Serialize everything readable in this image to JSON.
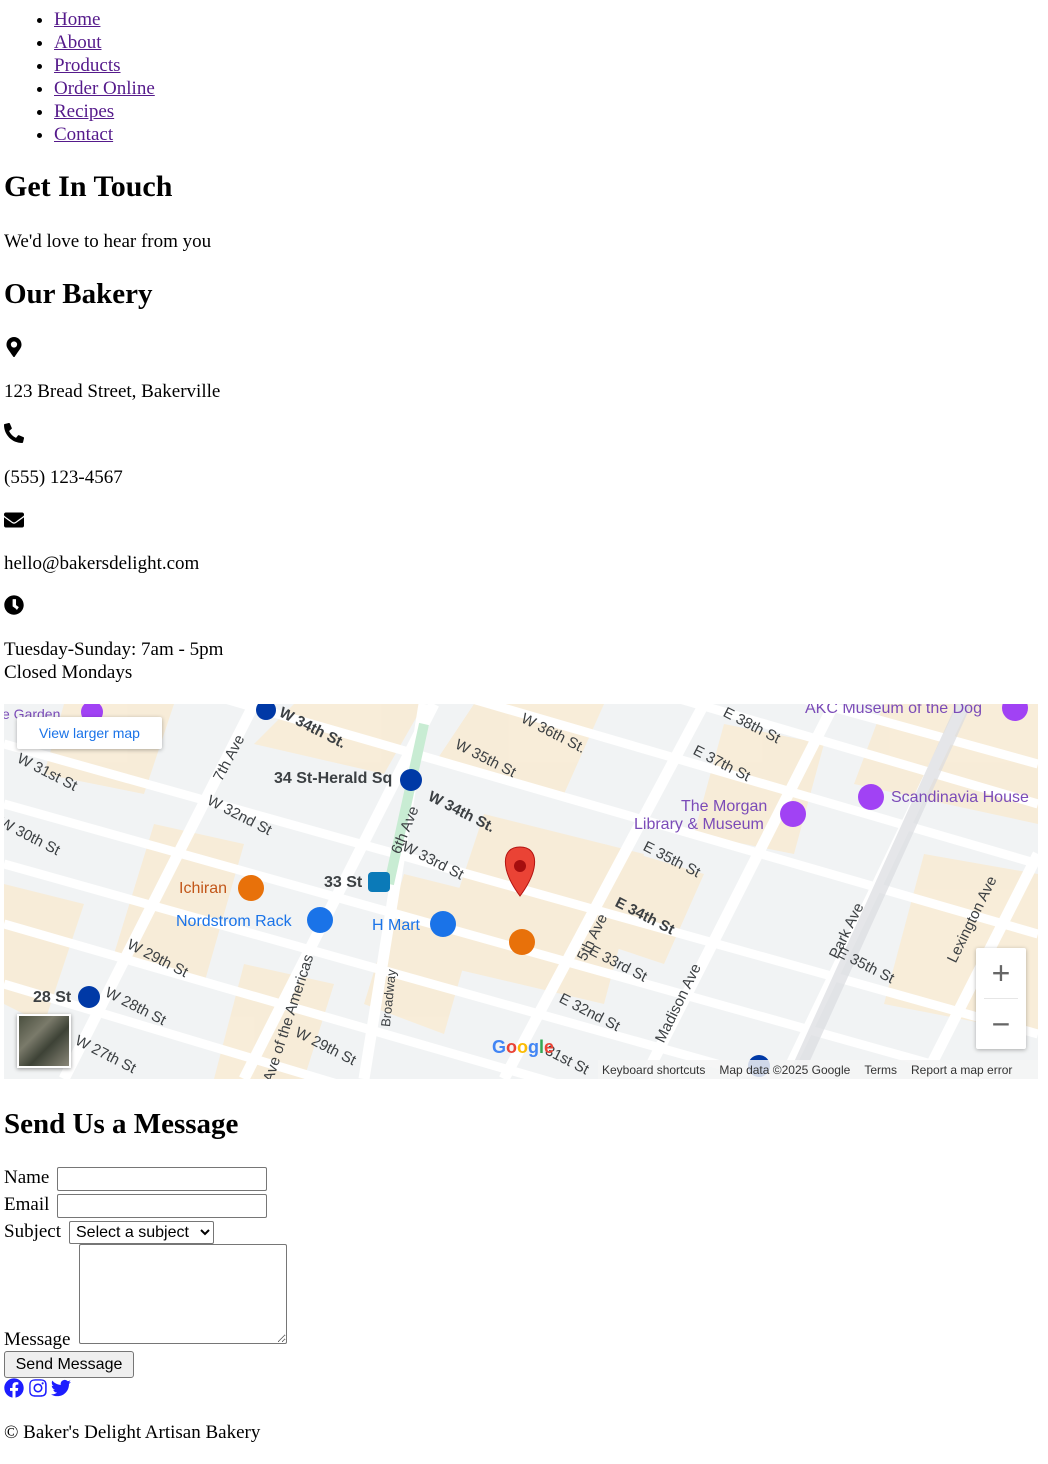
{
  "nav": {
    "items": [
      {
        "label": "Home"
      },
      {
        "label": "About"
      },
      {
        "label": "Products"
      },
      {
        "label": "Order Online"
      },
      {
        "label": "Recipes"
      },
      {
        "label": "Contact"
      }
    ]
  },
  "hero": {
    "title": "Get In Touch",
    "subtitle": "We'd love to hear from you"
  },
  "bakery": {
    "title": "Our Bakery",
    "address": "123 Bread Street, Bakerville",
    "phone": "(555) 123-4567",
    "email": "hello@bakersdelight.com",
    "hours_line1": "Tuesday-Sunday: 7am - 5pm",
    "hours_line2": "Closed Mondays",
    "icons": [
      "map-marker-icon",
      "phone-icon",
      "envelope-icon",
      "clock-icon"
    ]
  },
  "map": {
    "view_larger": "View larger map",
    "zoom_in": "+",
    "zoom_out": "−",
    "footer": {
      "keyboard": "Keyboard shortcuts",
      "data": "Map data ©2025 Google",
      "terms": "Terms",
      "report": "Report a map error"
    },
    "google_logo": "Google",
    "streets": {
      "w34": "W 34th St.",
      "w34b": "W 34th St.",
      "w35": "W 35th St",
      "w36": "W 36th St.",
      "e38": "E 38th St",
      "e37": "E 37th St",
      "e35": "E 35th St",
      "e34": "E 34th St",
      "e33": "E 33rd St",
      "e32": "E 32nd St",
      "w32": "W 32nd St",
      "w33": "W 33rd St",
      "w31": "W 31st St",
      "w30": "W 30th St",
      "w29": "W 29th St",
      "w29b": "W 29th St",
      "w28": "W 28th St",
      "w27": "W 27th St",
      "ave7": "7th Ave",
      "ave6": "6th Ave",
      "ave5": "5th Ave",
      "madison": "Madison Ave",
      "park": "Park Ave",
      "lexington": "Lexington Ave",
      "broadway": "Broadway",
      "americas": "Ave of the Americas",
      "e35b": "E 35th St",
      "w31b": "31st St"
    },
    "places": {
      "herald": "34 St-Herald Sq",
      "st33": "33 St",
      "st28": "28 St",
      "ichiran": "Ichiran",
      "nordstrom": "Nordstrom Rack",
      "hmart": "H Mart",
      "morgan1": "The Morgan",
      "morgan2": "Library & Museum",
      "akc": "AKC Museum of the Dog",
      "scandinavia": "Scandinavia House",
      "garden": "e Garden"
    },
    "colors": {
      "pin": "#ea4335",
      "road": "#ffffff",
      "block": "#f8ecd6",
      "poi_orange": "#e8710a",
      "poi_blue": "#1a73e8",
      "poi_purple": "#a142f4",
      "subway": "#0039a6"
    }
  },
  "form": {
    "title": "Send Us a Message",
    "name_label": "Name",
    "email_label": "Email",
    "subject_label": "Subject",
    "subject_selected": "Select a subject",
    "message_label": "Message",
    "submit_label": "Send Message"
  },
  "social": {
    "icons": [
      "facebook-icon",
      "instagram-icon",
      "twitter-icon"
    ],
    "color": "#1d1dff"
  },
  "footer": {
    "copyright": "© Baker's Delight Artisan Bakery"
  }
}
